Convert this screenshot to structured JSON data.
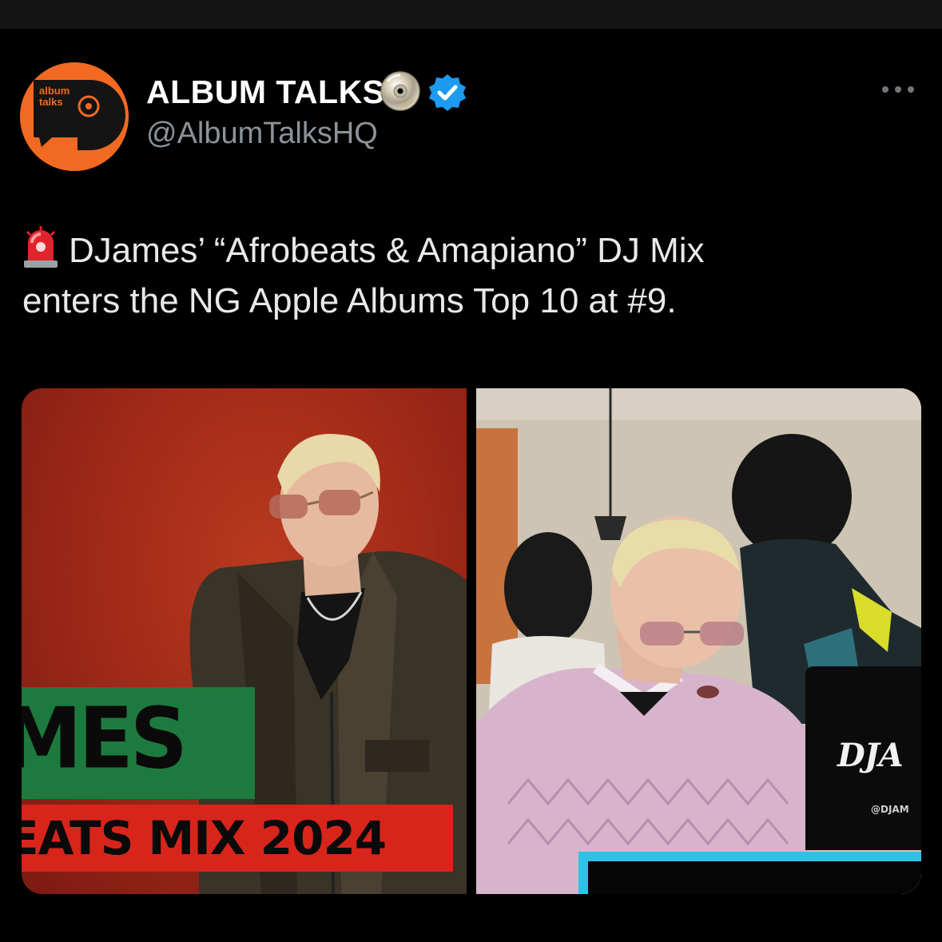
{
  "header": {
    "display_name": "ALBUM TALKS",
    "handle": "@AlbumTalksHQ",
    "avatar_text": [
      "album",
      "talks"
    ],
    "icons": {
      "name_emoji": "cd-icon",
      "verified": "verified-badge-icon",
      "more": "more-options-icon"
    }
  },
  "tweet": {
    "emoji": "siren-icon",
    "line1": "DJames’ “Afrobeats & Amapiano” DJ Mix",
    "line2": "enters the NG Apple Albums Top 10 at #9."
  },
  "media": {
    "left": {
      "cover_text_1": "MES",
      "cover_text_2": "EATS MIX 2024"
    },
    "right": {
      "laptop_logo": "DJA",
      "laptop_handle": "@DJAM"
    }
  },
  "colors": {
    "background": "#000000",
    "avatar_orange": "#f26a21",
    "verified_blue": "#1d9bf0",
    "cover_green": "#1d7a3e",
    "cover_red": "#d8251b",
    "frame_cyan": "#2ec3e6"
  }
}
